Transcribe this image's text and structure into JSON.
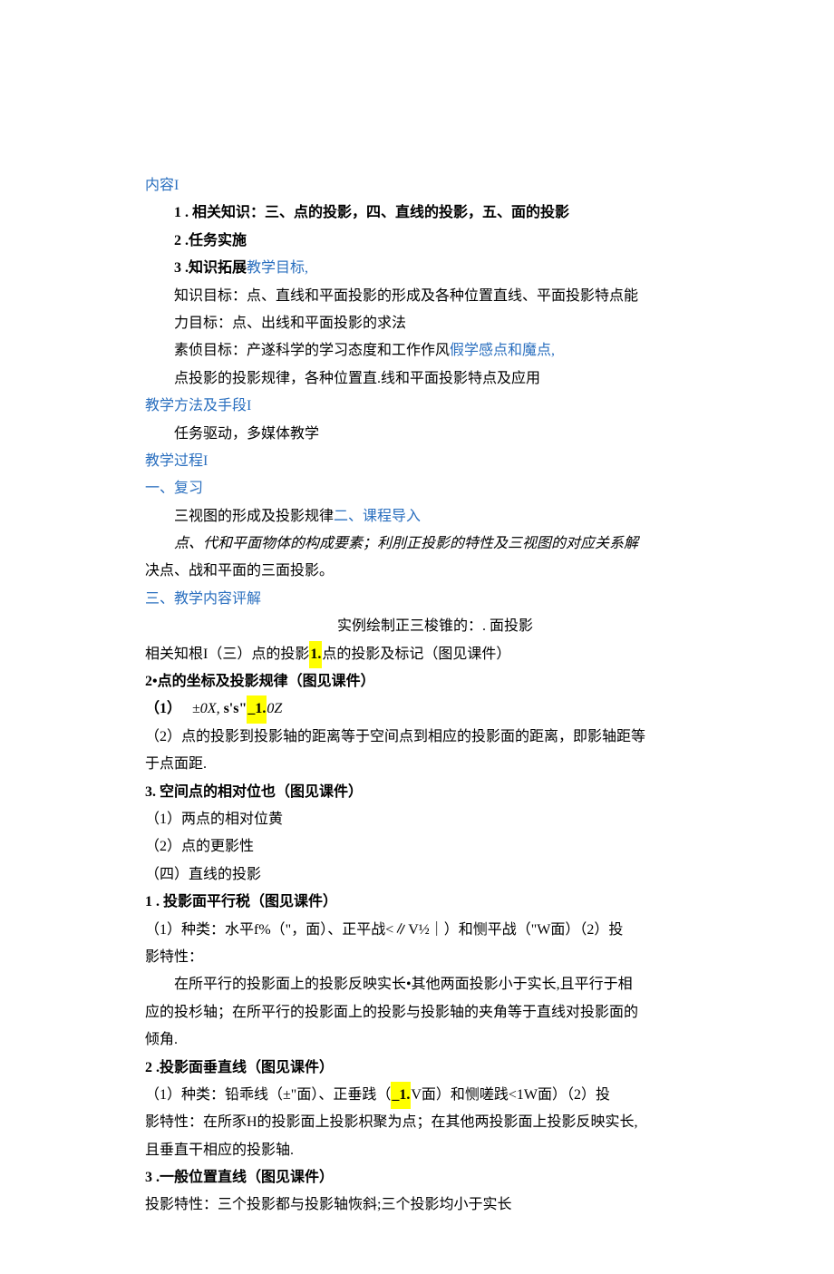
{
  "s1_title": "内容I",
  "s1_l1": "1 . 相关知识：三、点的投影，四、直线的投影，五、面的投影",
  "s1_l2": "2 .任务实施",
  "s1_l3_a": "3 .知识拓展",
  "s1_l3_b": "教学目标,",
  "s1_l4": "知识目标：点、直线和平面投影的形成及各种位置直线、平面投影特点能",
  "s1_l5": "力目标：点、出线和平面投影的求法",
  "s1_l6_a": "素侦目标：产遂科学的学习态度和工作作风",
  "s1_l6_b": "假学感点和魔点,",
  "s1_l7": "点投影的投影规律，各种位置直.线和平面投影特点及应用",
  "s2_title": "教学方法及手段I",
  "s2_l1": "任务驱动，多媒体教学",
  "s3_title": "教学过程I",
  "s4_title": "一、复习",
  "s4_l1_a": "三视图的形成及投影规律",
  "s4_l1_b": "二、课程导入",
  "s4_l2": "点、代和平面物体的构成要素；利刖正投影的特性及三视图的对应关系解",
  "s4_l3": "决点、战和平面的三面投影。",
  "s5_title": "三、教学内容评解",
  "s5_l1": "实例绘制正三梭锥的：. 面投影",
  "s5_l2_a": "相关知根I（三）点的投影",
  "s5_l2_hl": "1.",
  "s5_l2_b": "点的投影及标记（图见课件）",
  "s5_l3": "2•点的坐标及投影规律（图见课件）",
  "s5_l4_a": "（1）",
  "s5_l4_b": "±0X,",
  "s5_l4_c": "s's\"",
  "s5_l4_hl": "_1.",
  "s5_l4_d": "0Z",
  "s5_l5": "（2）点的投影到投影轴的距离等于空间点到相应的投影面的距离，即影轴距等",
  "s5_l6": "于点面距.",
  "s5_l7": "3. 空间点的相对位也（图见课件）",
  "s5_l8": "（1）两点的相对位黄",
  "s5_l9": "（2）点的更影性",
  "s5_l10": "（四）直线的投影",
  "s5_l11": "1 . 投影面平行税（图见课件）",
  "s5_l12": "（1）种类：水平f%（\"，面）、正平战<∥V½｜）和恻平战（\"W面）（2）投",
  "s5_l13": "影特性：",
  "s5_l14": "在所平行的投影面上的投影反映实长•其他两面投影小于实长,且平行于相",
  "s5_l15": "应的投杉轴；在所平行的投影面上的投影与投影轴的夹角等于直线对投影面的",
  "s5_l16": "倾角.",
  "s5_l17": "2 .投影面垂直线（图见课件）",
  "s5_l18_a": "（1）种类：铅乖线（±\"面）、正垂践（",
  "s5_l18_hl": "_1.",
  "s5_l18_b": "V面）和恻嗟践<1W面）（2）投",
  "s5_l19": "影特性：在所豕H的投影面上投影枳聚为点；在其他两投影面上投影反映实长,",
  "s5_l20": "且垂直干相应的投影轴.",
  "s5_l21": "3 .一般位置直线（图见课件）",
  "s5_l22": "投影特性：三个投影都与投影轴恢斜;三个投影均小于实长"
}
